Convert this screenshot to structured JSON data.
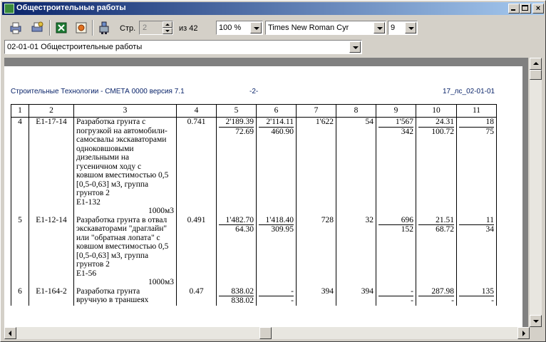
{
  "window": {
    "title": "Общестроительные работы"
  },
  "toolbar": {
    "page_label": "Стр.",
    "page_value": "2",
    "page_of": "из 42",
    "zoom": "100 %",
    "font": "Times New Roman Cyr",
    "font_size": "9",
    "icons": [
      "printer-icon",
      "print-setup-icon",
      "excel-icon",
      "export-icon",
      "properties-icon"
    ]
  },
  "section_select": {
    "value": "02-01-01  Общестроительные работы"
  },
  "document": {
    "header_left": "Строительные Технологии - СМЕТА 0000 версия 7.1",
    "header_center": "-2-",
    "header_right": "17_лс_02-01-01",
    "columns": [
      "1",
      "2",
      "3",
      "4",
      "5",
      "6",
      "7",
      "8",
      "9",
      "10",
      "11"
    ],
    "rows": [
      {
        "num": "4",
        "code": "Е1-17-14",
        "desc_lines": [
          "Разработка грунта с",
          "погрузкой на автомобили-",
          "самосвалы экскаваторами",
          "одноковшовыми",
          "дизельными на",
          "гусеничном ходу с",
          "ковшом вместимостью 0,5",
          "[0,5-0,63] м3, группа",
          "грунтов 2",
          "Е1-132"
        ],
        "unit": "1000м3",
        "qty": "0.741",
        "c5": [
          "2'189.39",
          "72.69"
        ],
        "c6": [
          "2'114.11",
          "460.90"
        ],
        "c7": "1'622",
        "c8": "54",
        "c9": [
          "1'567",
          "342"
        ],
        "c10": [
          "24.31",
          "100.72"
        ],
        "c11": [
          "18",
          "75"
        ]
      },
      {
        "num": "5",
        "code": "Е1-12-14",
        "desc_lines": [
          "Разработка грунта в отвал",
          "экскаваторами \"драглайн\"",
          "или \"обратная лопата\" с",
          "ковшом вместимостью 0,5",
          "[0,5-0,63] м3, группа",
          "грунтов 2",
          "Е1-56"
        ],
        "unit": "1000м3",
        "qty": "0.491",
        "c5": [
          "1'482.70",
          "64.30"
        ],
        "c6": [
          "1'418.40",
          "309.95"
        ],
        "c7": "728",
        "c8": "32",
        "c9": [
          "696",
          "152"
        ],
        "c10": [
          "21.51",
          "68.72"
        ],
        "c11": [
          "11",
          "34"
        ]
      },
      {
        "num": "6",
        "code": "Е1-164-2",
        "desc_lines": [
          "Разработка грунта",
          "вручную в траншеях"
        ],
        "unit": "",
        "qty": "0.47",
        "c5": [
          "838.02",
          "838.02"
        ],
        "c6": [
          "-",
          "-"
        ],
        "c7": "394",
        "c8": "394",
        "c9": [
          "-",
          "-"
        ],
        "c10": [
          "287.98",
          "-"
        ],
        "c11": [
          "135",
          "-"
        ]
      }
    ]
  }
}
